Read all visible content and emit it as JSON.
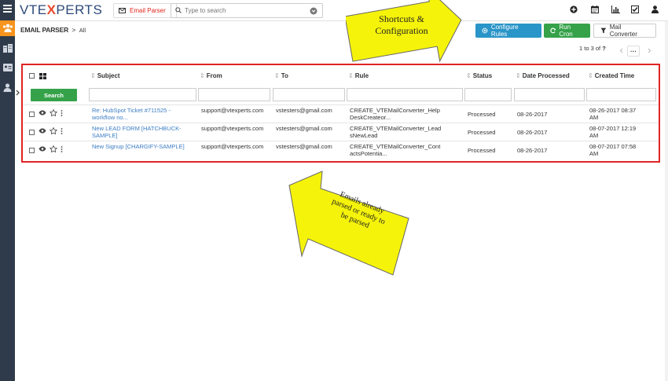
{
  "app": {
    "logo_part1": "VTE",
    "logo_part2": "X",
    "logo_part3": "PERTS",
    "module_button": "Email Parser",
    "search_placeholder": "Type to search"
  },
  "page": {
    "module_name": "EMAIL PARSER",
    "separator": ">",
    "view_name": "All"
  },
  "actions": {
    "configure_rules": "Configure Rules",
    "run_cron": "Run Cron",
    "mail_converter": "Mail Converter"
  },
  "pagination": {
    "text": "1 to 3  of ",
    "total": "?",
    "more": "···"
  },
  "table": {
    "headers": {
      "subject": "Subject",
      "from": "From",
      "to": "To",
      "rule": "Rule",
      "status": "Status",
      "date_processed": "Date Processed",
      "created_time": "Created Time"
    },
    "search_label": "Search",
    "rows": [
      {
        "subject": "Re: HubSpot Ticket #711525 - workflow no...",
        "from": "support@vtexperts.com",
        "to": "vstesters@gmail.com",
        "rule": "CREATE_VTEMailConverter_HelpDeskCreateor...",
        "status": "Processed",
        "date_processed": "08-26-2017",
        "created_time": "08-26-2017 08:37 AM"
      },
      {
        "subject": "New LEAD FORM [HATCHBUCK-SAMPLE]",
        "from": "support@vtexperts.com",
        "to": "vstesters@gmail.com",
        "rule": "CREATE_VTEMailConverter_LeadsNewLead",
        "status": "Processed",
        "date_processed": "08-26-2017",
        "created_time": "08-07-2017 12:19 AM"
      },
      {
        "subject": "New Signup [CHARGIFY-SAMPLE]",
        "from": "support@vtexperts.com",
        "to": "vstesters@gmail.com",
        "rule": "CREATE_VTEMailConverter_ContactsPotentia...",
        "status": "Processed",
        "date_processed": "08-26-2017",
        "created_time": "08-07-2017 07:58 AM"
      }
    ]
  },
  "annotations": {
    "top_line1": "Shortcuts &",
    "top_line2": "Configuration",
    "bottom_line1": "Emails already",
    "bottom_line2": "parsed or ready to",
    "bottom_line3": "be parsed"
  },
  "colors": {
    "sidebar": "#2f3b4a",
    "accent_orange": "#f7941d",
    "btn_blue": "#2a95c8",
    "btn_green": "#35a24a",
    "highlight_red": "#e02424",
    "annotation_yellow": "#f5f30a"
  }
}
